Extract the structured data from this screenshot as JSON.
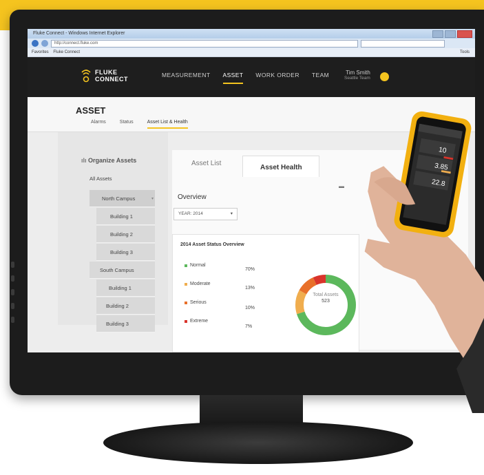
{
  "browser": {
    "title": "Fluke Connect - Windows Internet Explorer",
    "url": "http://connect.fluke.com",
    "favorites_label": "Favorites",
    "tab_label": "Fluke Connect",
    "tools_label": "Tools"
  },
  "app": {
    "brand_line1": "FLUKE",
    "brand_line2": "CONNECT",
    "nav": [
      "MEASUREMENT",
      "ASSET",
      "WORK ORDER",
      "TEAM"
    ],
    "active_nav": "ASSET",
    "user_name": "Tim Smith",
    "user_team": "Seattle Team"
  },
  "page": {
    "title": "ASSET",
    "sub_tabs": [
      "Alarms",
      "Status",
      "Asset List & Health"
    ],
    "active_sub_tab": "Asset List & Health"
  },
  "sidebar": {
    "title": "Organize Assets",
    "items": [
      "All Assets",
      "North Campus",
      "Building 1",
      "Building 2",
      "Building 3",
      "South Campus",
      "Building 1",
      "Building 2",
      "Building 3"
    ]
  },
  "panel": {
    "tabs": [
      "Asset List",
      "Asset Health"
    ],
    "active_tab": "Asset Health",
    "overview_label": "Overview",
    "year_select": "YEAR: 2014"
  },
  "status_card": {
    "title": "2014 Asset Status Overview",
    "rows": [
      {
        "label": "Normal",
        "pct": "70%",
        "color": "#5cb85c"
      },
      {
        "label": "Moderate",
        "pct": "13%",
        "color": "#f0ad4e"
      },
      {
        "label": "Serious",
        "pct": "10%",
        "color": "#e8702a"
      },
      {
        "label": "Extreme",
        "pct": "7%",
        "color": "#d9342b"
      }
    ],
    "total_label": "Total Assets",
    "total_value": "523"
  },
  "phone": {
    "values": [
      "10",
      "3.85",
      "22.8"
    ]
  },
  "colors": {
    "accent": "#f5c41f",
    "header": "#1e1e1e"
  }
}
